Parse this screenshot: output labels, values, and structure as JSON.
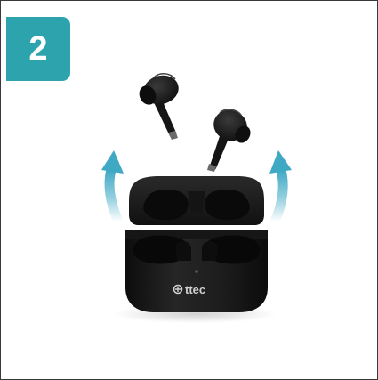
{
  "step": {
    "number": "2"
  },
  "product": {
    "brand": "ttec",
    "colors": {
      "badge": "#2ca3ad",
      "arrow": "#3fa9c4",
      "case": "#1a1a1a",
      "earbud": "#1b1b1b"
    },
    "icons": [
      "up-arrow-icon",
      "brand-logo-icon"
    ]
  }
}
